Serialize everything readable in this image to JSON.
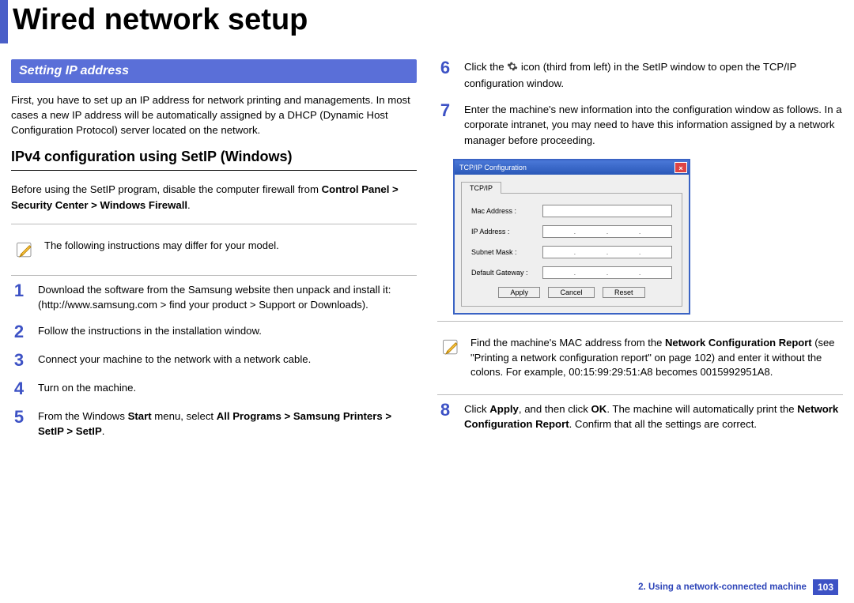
{
  "page_title": "Wired network setup",
  "left": {
    "banner": "Setting IP address",
    "intro": "First, you have to set up an IP address for network printing and managements. In most cases a new IP address will be automatically assigned by a DHCP (Dynamic Host Configuration Protocol) server located on the network.",
    "subheading": "IPv4 configuration using SetIP (Windows)",
    "before_lead": "Before using the SetIP program, disable the computer firewall from ",
    "before_bold": "Control Panel > Security Center > Windows Firewall",
    "before_tail": ".",
    "note": "The following instructions may differ for your model.",
    "steps": {
      "1": "Download the software from the Samsung website then unpack and install it: (http://www.samsung.com > find your product > Support or Downloads).",
      "2": "Follow the instructions in the installation window.",
      "3": "Connect your machine to the network with a network cable.",
      "4": "Turn on the machine.",
      "5_a": "From the Windows ",
      "5_b": "Start",
      "5_c": " menu, select ",
      "5_d": "All Programs > Samsung Printers > SetIP > SetIP",
      "5_e": "."
    }
  },
  "right": {
    "step6_a": "Click the ",
    "step6_b": " icon (third from left) in the SetIP window to open the TCP/IP configuration window.",
    "step7": "Enter the machine's new information into the configuration window as follows. In a corporate intranet, you may need to have this information assigned by a network manager before proceeding.",
    "dialog": {
      "title": "TCP/IP Configuration",
      "tab": "TCP/IP",
      "rows": {
        "mac": "Mac Address :",
        "ip": "IP Address :",
        "subnet": "Subnet Mask :",
        "gateway": "Default Gateway :"
      },
      "buttons": {
        "apply": "Apply",
        "cancel": "Cancel",
        "reset": "Reset"
      }
    },
    "note2_a": "Find the machine's MAC address from the ",
    "note2_b": "Network Configuration Report",
    "note2_c": " (see \"Printing a network configuration report\" on page 102) and enter it without the colons. For example, 00:15:99:29:51:A8 becomes 0015992951A8.",
    "step8_a": "Click ",
    "step8_b": "Apply",
    "step8_c": ", and then click ",
    "step8_d": "OK",
    "step8_e": ". The machine will automatically print the ",
    "step8_f": "Network Configuration Report",
    "step8_g": ". Confirm that all the settings are correct."
  },
  "footer": {
    "chapter": "2.  Using a network-connected machine",
    "page": "103"
  },
  "nums": {
    "n1": "1",
    "n2": "2",
    "n3": "3",
    "n4": "4",
    "n5": "5",
    "n6": "6",
    "n7": "7",
    "n8": "8"
  }
}
